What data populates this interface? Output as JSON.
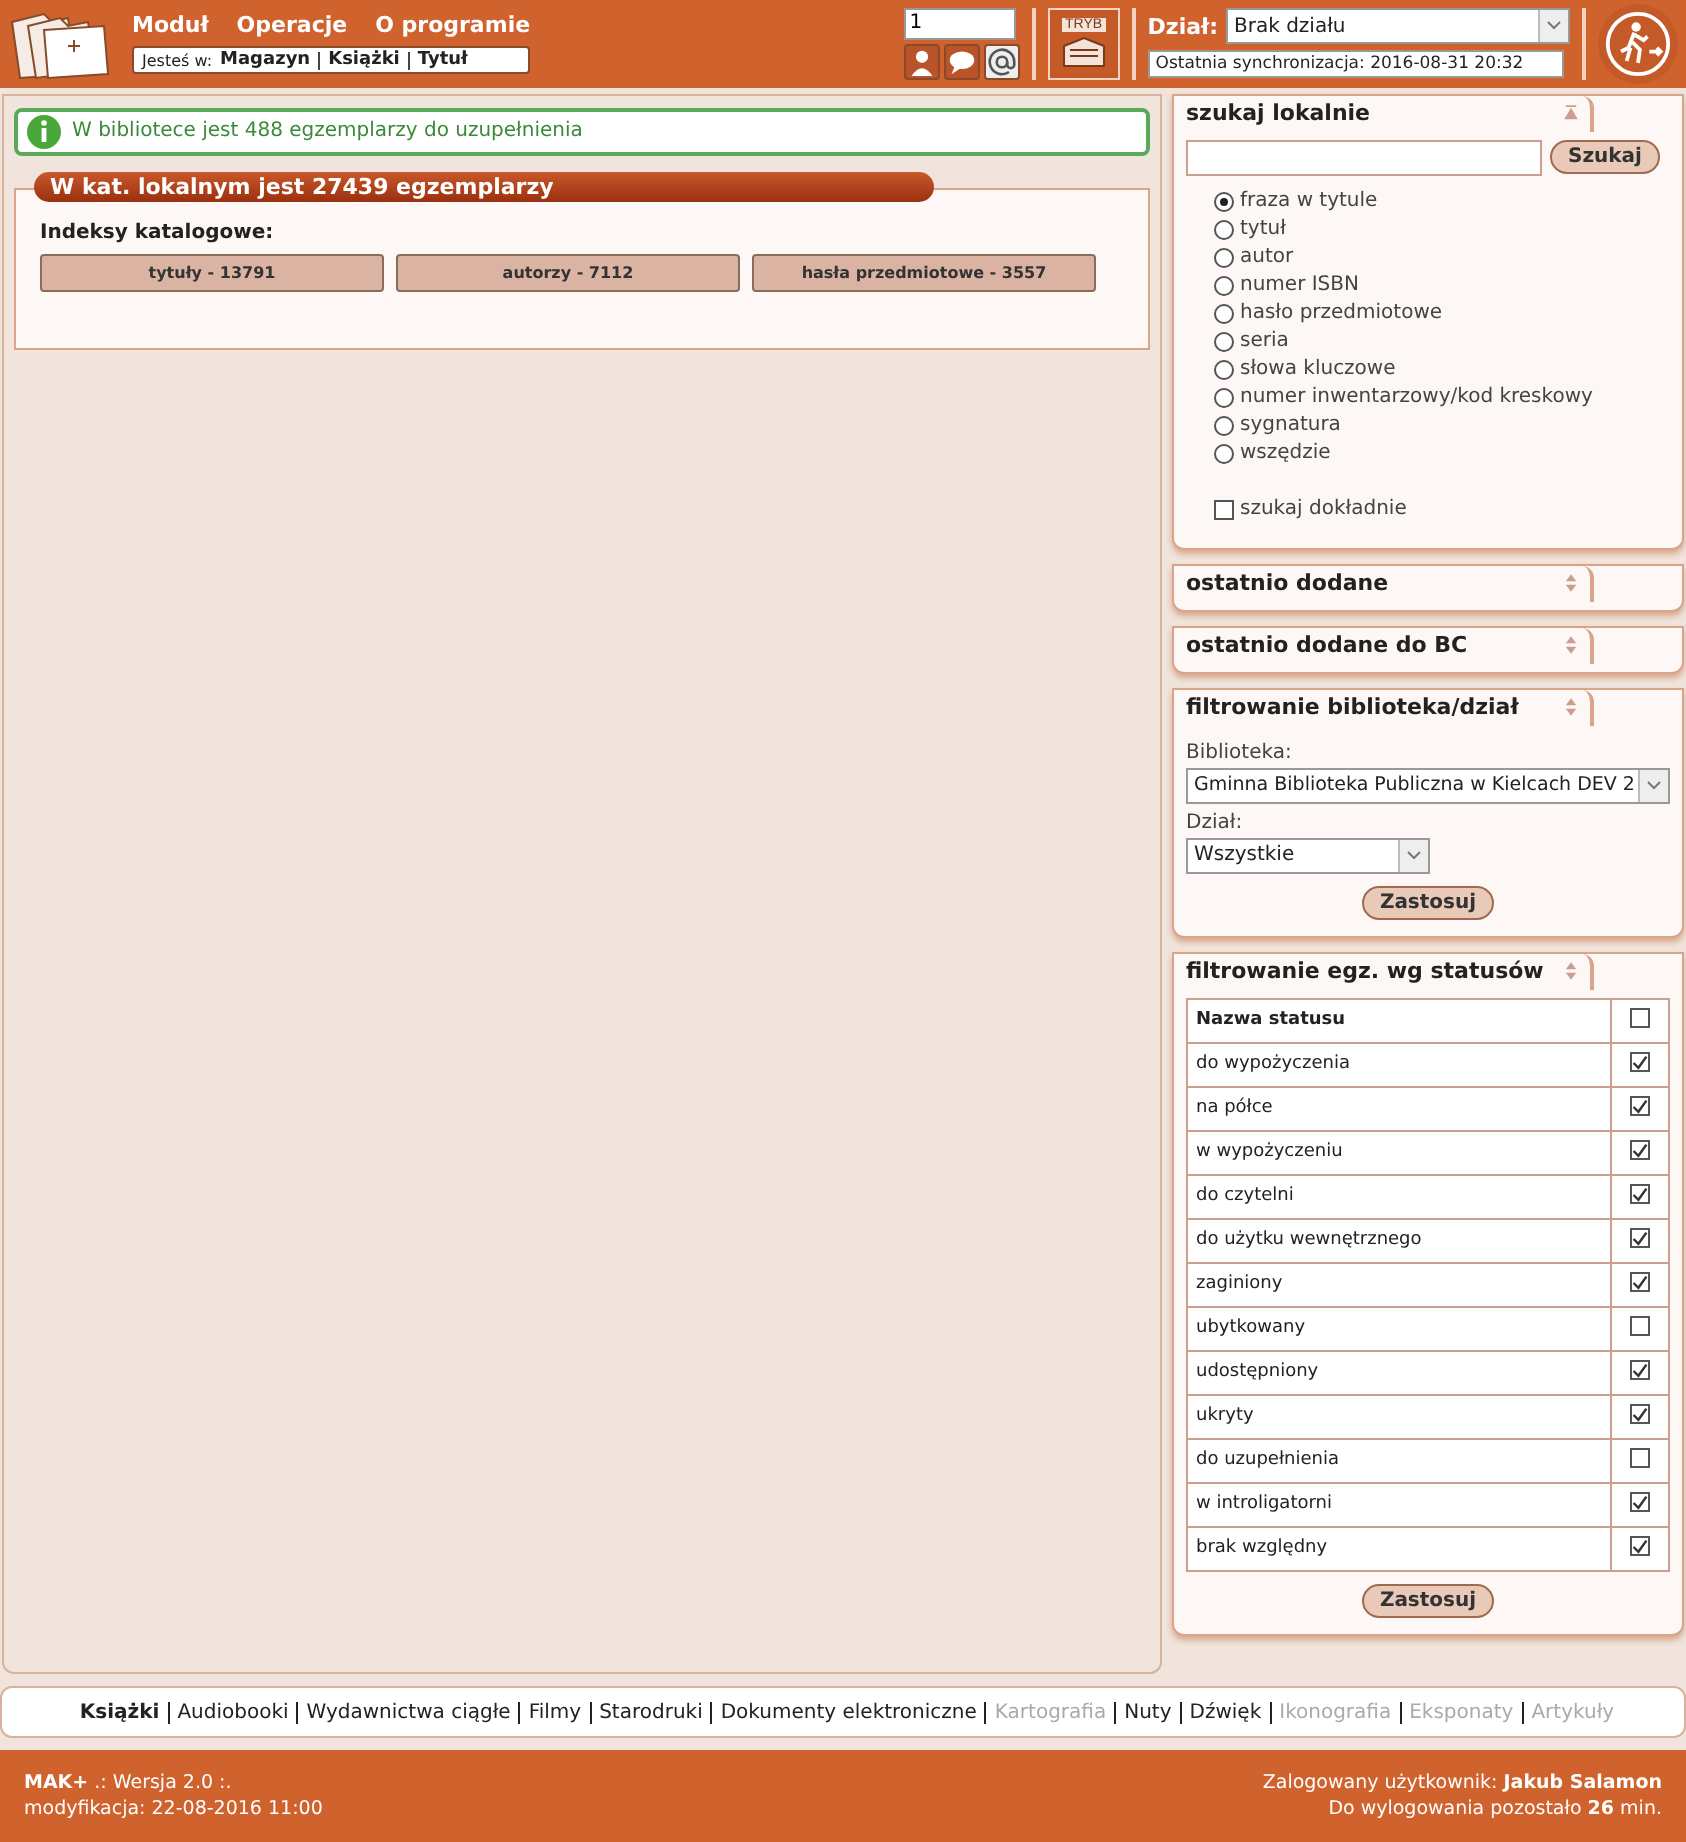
{
  "header": {
    "menu": [
      "Moduł",
      "Operacje",
      "O programie"
    ],
    "breadcrumb_label": "Jesteś w:",
    "breadcrumb": [
      "Magazyn",
      "Książki",
      "Tytuł"
    ],
    "number_field": "1",
    "mode_label": "TRYB",
    "department_label": "Dział:",
    "department_value": "Brak działu",
    "sync": "Ostatnia synchronizacja: 2016-08-31 20:32"
  },
  "info": "W bibliotece jest 488 egzemplarzy do uzupełnienia",
  "catalog": {
    "title": "W kat. lokalnym jest 27439 egzemplarzy",
    "subtitle": "Indeksy katalogowe:",
    "buttons": [
      "tytuły - 13791",
      "autorzy - 7112",
      "hasła przedmiotowe - 3557"
    ]
  },
  "search": {
    "title": "szukaj lokalnie",
    "button": "Szukaj",
    "options": [
      {
        "label": "fraza w tytule",
        "selected": true
      },
      {
        "label": "tytuł",
        "selected": false
      },
      {
        "label": "autor",
        "selected": false
      },
      {
        "label": "numer ISBN",
        "selected": false
      },
      {
        "label": "hasło przedmiotowe",
        "selected": false
      },
      {
        "label": "seria",
        "selected": false
      },
      {
        "label": "słowa kluczowe",
        "selected": false
      },
      {
        "label": "numer inwentarzowy/kod kreskowy",
        "selected": false
      },
      {
        "label": "sygnatura",
        "selected": false
      },
      {
        "label": "wszędzie",
        "selected": false
      }
    ],
    "exact": {
      "label": "szukaj dokładnie",
      "checked": false
    }
  },
  "collapsed_panels": [
    "ostatnio dodane",
    "ostatnio dodane do BC"
  ],
  "library_filter": {
    "title": "filtrowanie biblioteka/dział",
    "library_label": "Biblioteka:",
    "library_value": "Gminna Biblioteka Publiczna w Kielcach DEV 2",
    "department_label": "Dział:",
    "department_value": "Wszystkie",
    "button": "Zastosuj"
  },
  "status_filter": {
    "title": "filtrowanie egz. wg statusów",
    "column": "Nazwa statusu",
    "all_checked": false,
    "button": "Zastosuj",
    "rows": [
      {
        "name": "do wypożyczenia",
        "checked": true
      },
      {
        "name": "na półce",
        "checked": true
      },
      {
        "name": "w wypożyczeniu",
        "checked": true
      },
      {
        "name": "do czytelni",
        "checked": true
      },
      {
        "name": "do użytku wewnętrznego",
        "checked": true
      },
      {
        "name": "zaginiony",
        "checked": true
      },
      {
        "name": "ubytkowany",
        "checked": false
      },
      {
        "name": "udostępniony",
        "checked": true
      },
      {
        "name": "ukryty",
        "checked": true
      },
      {
        "name": "do uzupełnienia",
        "checked": false
      },
      {
        "name": "w introligatorni",
        "checked": true
      },
      {
        "name": "brak względny",
        "checked": true
      }
    ]
  },
  "categories": [
    {
      "label": "Książki",
      "selected": true,
      "disabled": false
    },
    {
      "label": "Audiobooki",
      "selected": false,
      "disabled": false
    },
    {
      "label": "Wydawnictwa ciągłe",
      "selected": false,
      "disabled": false
    },
    {
      "label": "Filmy",
      "selected": false,
      "disabled": false
    },
    {
      "label": "Starodruki",
      "selected": false,
      "disabled": false
    },
    {
      "label": "Dokumenty elektroniczne",
      "selected": false,
      "disabled": false
    },
    {
      "label": "Kartografia",
      "selected": false,
      "disabled": true
    },
    {
      "label": "Nuty",
      "selected": false,
      "disabled": false
    },
    {
      "label": "Dźwięk",
      "selected": false,
      "disabled": false
    },
    {
      "label": "Ikonografia",
      "selected": false,
      "disabled": true
    },
    {
      "label": "Eksponaty",
      "selected": false,
      "disabled": true
    },
    {
      "label": "Artykuły",
      "selected": false,
      "disabled": true
    }
  ],
  "footer": {
    "version": "**MAK+** .: Wersja 2.0 :.",
    "modified": "modyfikacja: 22-08-2016 11:00",
    "user": "Zalogowany użytkownik: **Jakub Salamon**",
    "logout": "Do wylogowania pozostało **26** min."
  }
}
